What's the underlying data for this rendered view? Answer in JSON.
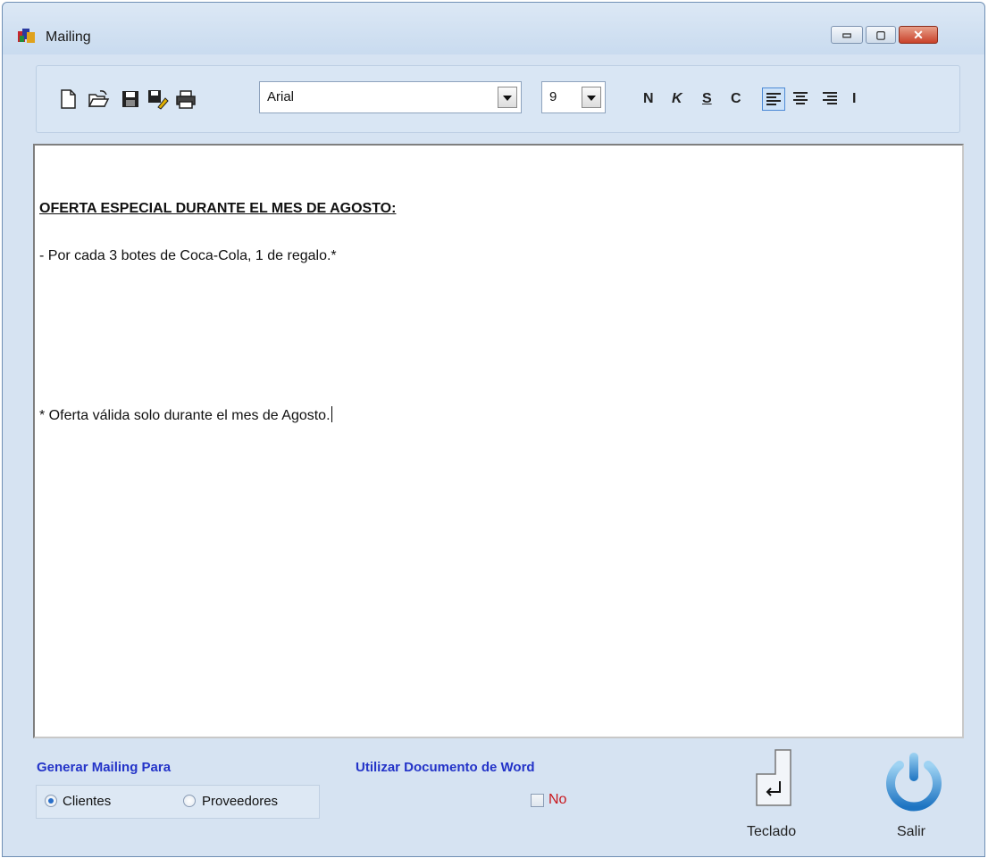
{
  "window": {
    "title": "Mailing",
    "controls": {
      "minimize": "▭",
      "maximize": "▢",
      "close": "✕"
    }
  },
  "toolbar": {
    "icons": [
      "new-document-icon",
      "open-folder-icon",
      "save-icon",
      "save-as-icon",
      "print-icon"
    ],
    "font": {
      "value": "Arial"
    },
    "size": {
      "value": "9"
    },
    "format_buttons": {
      "bold": "N",
      "italic": "K",
      "underline": "S",
      "strike": "C"
    },
    "align_buttons": [
      "align-left",
      "align-center",
      "align-right"
    ],
    "indent_label": "I",
    "active_align": "align-left"
  },
  "editor": {
    "heading": "OFERTA ESPECIAL DURANTE EL MES DE AGOSTO:",
    "line1": "- Por cada 3 botes de Coca-Cola, 1 de regalo.*",
    "footnote": "* Oferta válida solo durante el mes de Agosto."
  },
  "footer": {
    "generar_label": "Generar Mailing Para",
    "options": [
      {
        "label": "Clientes",
        "selected": true
      },
      {
        "label": "Proveedores",
        "selected": false
      }
    ],
    "word_label": "Utilizar Documento de Word",
    "word_value": "No",
    "teclado_label": "Teclado",
    "salir_label": "Salir"
  },
  "colors": {
    "accent_blue": "#2333c8",
    "no_red": "#c8171d",
    "window_bg": "#d6e3f2"
  }
}
